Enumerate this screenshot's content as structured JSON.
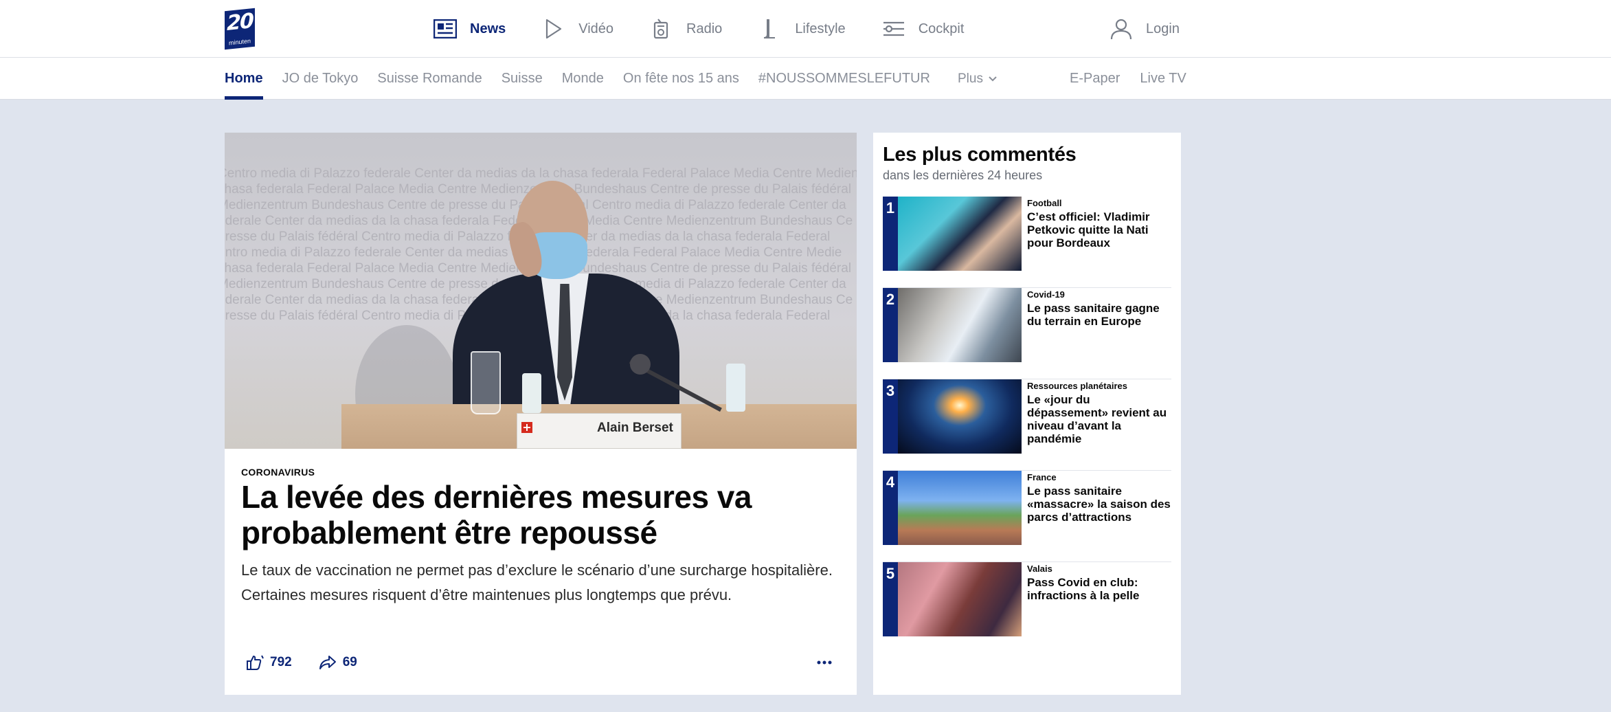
{
  "logo": {
    "number": "20",
    "word": "minuten"
  },
  "header": {
    "nav": [
      {
        "label": "News",
        "icon": "newspaper-icon",
        "active": true
      },
      {
        "label": "Vidéo",
        "icon": "play-icon",
        "active": false
      },
      {
        "label": "Radio",
        "icon": "radio-icon",
        "active": false
      },
      {
        "label": "Lifestyle",
        "icon": "lifestyle-icon",
        "active": false
      },
      {
        "label": "Cockpit",
        "icon": "cockpit-icon",
        "active": false
      }
    ],
    "login": {
      "label": "Login",
      "icon": "user-icon"
    }
  },
  "subnav": {
    "tabs": [
      "Home",
      "JO de Tokyo",
      "Suisse Romande",
      "Suisse",
      "Monde",
      "On fête nos 15 ans",
      "#NOUSSOMMESLEFUTUR"
    ],
    "more": "Plus",
    "right": [
      "E-Paper",
      "Live TV"
    ]
  },
  "article": {
    "placard_name": "Alain Berset",
    "kicker": "CORONAVIRUS",
    "headline": "La levée des dernières mesures va probablement être repoussé",
    "lead": "Le taux de vaccination ne permet pas d’exclure le scénario d’une surcharge hospitalière. Certaines mesures risquent d’être maintenues plus longtemps que prévu.",
    "reactions": "792",
    "shares": "69"
  },
  "hero_background_text": [
    "Centro media di Palazzo federale   Center da medias da la chasa federala   Federal Palace Media Centre   Medienzentrum",
    "chasa federala   Federal Palace Media Centre   Medienzentrum Bundeshaus   Centre de presse du Palais fédéral",
    "Medienzentrum Bundeshaus   Centre de presse du Palais fédéral   Centro media di Palazzo federale   Center da",
    "ederale   Center da medias da la chasa federala   Federal Palace Media Centre   Medienzentrum Bundeshaus   Ce",
    "presse du Palais fédéral   Centro media di Palazzo federale   Center da medias da la chasa federala   Federal",
    "entro media di Palazzo federale   Center da medias da la chasa federala   Federal Palace Media Centre   Medie",
    "chasa federala   Federal Palace Media Centre   Medienzentrum Bundeshaus   Centre de presse du Palais fédéral",
    "Medienzentrum Bundeshaus   Centre de presse du Palais fédéral   Centro media di Palazzo federale   Center da",
    "ederale   Center da medias da la chasa federala   Federal Palace Media Centre   Medienzentrum Bundeshaus   Ce",
    "presse du Palais fédéral   Centro media di Palazzo federale   Center da medias da la chasa federala   Federal"
  ],
  "sidebar": {
    "title": "Les plus commentés",
    "subtitle": "dans les dernières 24 heures",
    "items": [
      {
        "rank": "1",
        "category": "Football",
        "headline": "C’est officiel: Vladimir Petkovic quitte la Nati pour Bordeaux"
      },
      {
        "rank": "2",
        "category": "Covid-19",
        "headline": "Le pass sanitaire gagne du terrain en Europe"
      },
      {
        "rank": "3",
        "category": "Ressources planétaires",
        "headline": "Le «jour du dépassement» revient au niveau d’avant la pandémie"
      },
      {
        "rank": "4",
        "category": "France",
        "headline": "Le pass sanitaire «massacre» la saison des parcs d’attractions"
      },
      {
        "rank": "5",
        "category": "Valais",
        "headline": "Pass Covid en club: infractions à la pelle"
      }
    ]
  },
  "colors": {
    "brand": "#0d2677",
    "background": "#dfe4ee",
    "muted_text": "#8a8f99"
  }
}
